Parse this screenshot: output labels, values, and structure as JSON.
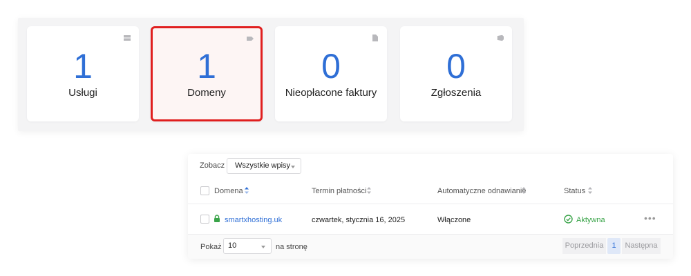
{
  "cards": [
    {
      "count": "1",
      "label": "Usługi",
      "icon": "server-icon"
    },
    {
      "count": "1",
      "label": "Domeny",
      "icon": "tag-icon"
    },
    {
      "count": "0",
      "label": "Nieopłacone faktury",
      "icon": "document-icon"
    },
    {
      "count": "0",
      "label": "Zgłoszenia",
      "icon": "ticket-icon"
    }
  ],
  "colors": {
    "accent": "#2f6fd6",
    "highlight_border": "#e01f1f",
    "status_active": "#3aa449"
  },
  "filter": {
    "label": "Zobacz",
    "value": "Wszystkie wpisy"
  },
  "table": {
    "headers": [
      "Domena",
      "Termin płatności",
      "Automatyczne odnawianie",
      "Status"
    ],
    "rows": [
      {
        "domain": "smartxhosting.uk",
        "due_date": "czwartek, stycznia 16, 2025",
        "auto_renew": "Włączone",
        "status": "Aktywna"
      }
    ]
  },
  "pagination": {
    "show_label": "Pokaż",
    "page_size": "10",
    "per_page_label": "na stronę",
    "prev": "Poprzednia",
    "current": "1",
    "next": "Następna"
  }
}
